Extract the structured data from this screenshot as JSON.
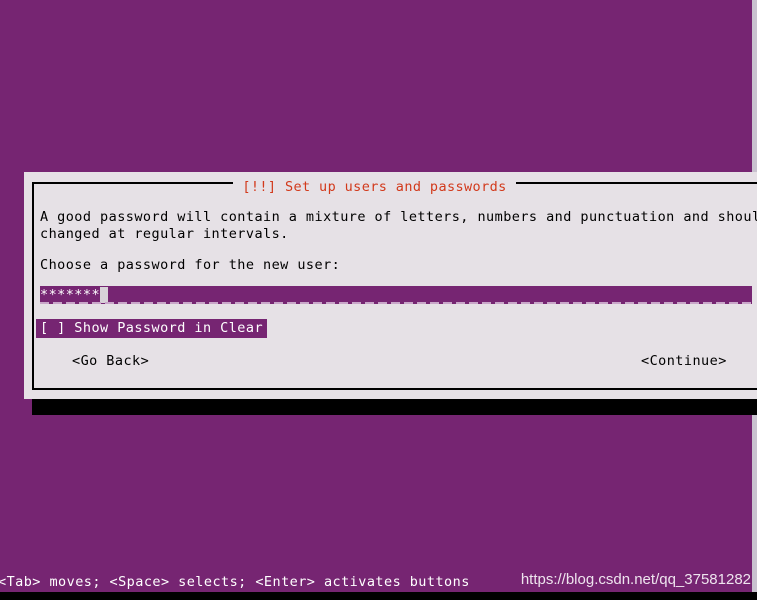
{
  "screen": {
    "background_color": "#762572",
    "shadow_color": "#000000",
    "right_border_color": "#c9c2cf"
  },
  "dialog": {
    "title": "[!!] Set up users and passwords",
    "title_color": "#d2391b",
    "background_color": "#e6e1e6",
    "border_color": "#000000",
    "intro_text": "A good password will contain a mixture of letters, numbers and punctuation and should be\nchanged at regular intervals.",
    "prompt_text": "Choose a password for the new user:"
  },
  "password_field": {
    "name": "password-input",
    "masked_value": "*******",
    "placeholder": "",
    "char_count": 7,
    "highlight_color": "#762572",
    "text_color": "#ffffff",
    "cursor_color": "#d8d2d8",
    "underline_color": "#c9a6c9"
  },
  "show_password": {
    "label": "[ ] Show Password in Clear",
    "checked": false,
    "checkbox_glyph": "[ ]",
    "focused": true,
    "highlight_color": "#762572",
    "text_color": "#ffffff"
  },
  "buttons": {
    "go_back": "<Go Back>",
    "continue": "<Continue>"
  },
  "footer": {
    "hint": "<Tab> moves; <Space> selects; <Enter> activates buttons",
    "watermark": "https://blog.csdn.net/qq_37581282"
  }
}
